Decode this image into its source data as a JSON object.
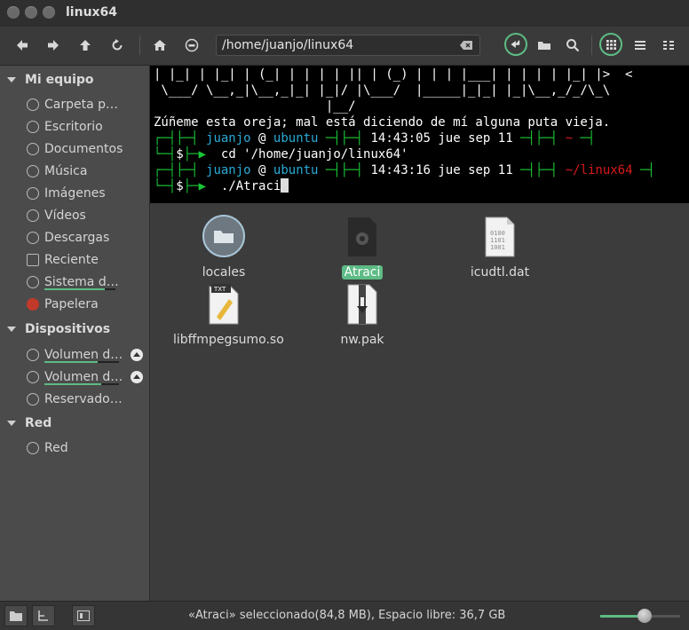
{
  "window": {
    "title": "linux64"
  },
  "toolbar": {
    "path": "/home/juanjo/linux64"
  },
  "sidebar": {
    "sections": [
      {
        "label": "Mi equipo",
        "items": [
          "Carpeta p…",
          "Escritorio",
          "Documentos",
          "Música",
          "Imágenes",
          "Vídeos",
          "Descargas",
          "Reciente",
          "Sistema d…",
          "Papelera"
        ]
      },
      {
        "label": "Dispositivos",
        "items": [
          "Volumen d…",
          "Volumen d…",
          "Reservado…"
        ]
      },
      {
        "label": "Red",
        "items": [
          "Red"
        ]
      }
    ]
  },
  "terminal": {
    "art1": "| |_| | |_| | (_| | | | | || | (_) | | | |___| | | | | |_| |>  <",
    "art2": " \\___/ \\__,_|\\__,_|_| |_|/ |\\___/  |_____|_|_| |_|\\__,_/_/\\_\\",
    "art3": "                       |__/",
    "quote": "Zúñeme esta oreja; mal está diciendo de mí alguna puta vieja.",
    "p1_user": "juanjo",
    "p1_at": "@",
    "p1_host": "ubuntu",
    "p1_time": "14:43:05 jue sep 11",
    "p1_dir": "~",
    "cmd1": "cd '/home/juanjo/linux64'",
    "p2_user": "juanjo",
    "p2_at": "@",
    "p2_host": "ubuntu",
    "p2_time": "14:43:16 jue sep 11",
    "p2_dir": "~/linux64",
    "cmd2": "./Atraci",
    "prompt_sym": "$"
  },
  "files": [
    {
      "name": "locales",
      "type": "folder"
    },
    {
      "name": "Atraci",
      "type": "executable",
      "selected": true
    },
    {
      "name": "icudtl.dat",
      "type": "binary"
    },
    {
      "name": "libffmpegsumo.so",
      "type": "text"
    },
    {
      "name": "nw.pak",
      "type": "archive"
    }
  ],
  "status": {
    "text": "«Atraci» seleccionado(84,8 MB), Espacio libre: 36,7 GB",
    "zoom_level": 0.55
  },
  "colors": {
    "accent": "#5dbb85",
    "term_green": "#19c337",
    "term_cyan": "#2aa9d6",
    "term_red": "#d81b1b"
  }
}
